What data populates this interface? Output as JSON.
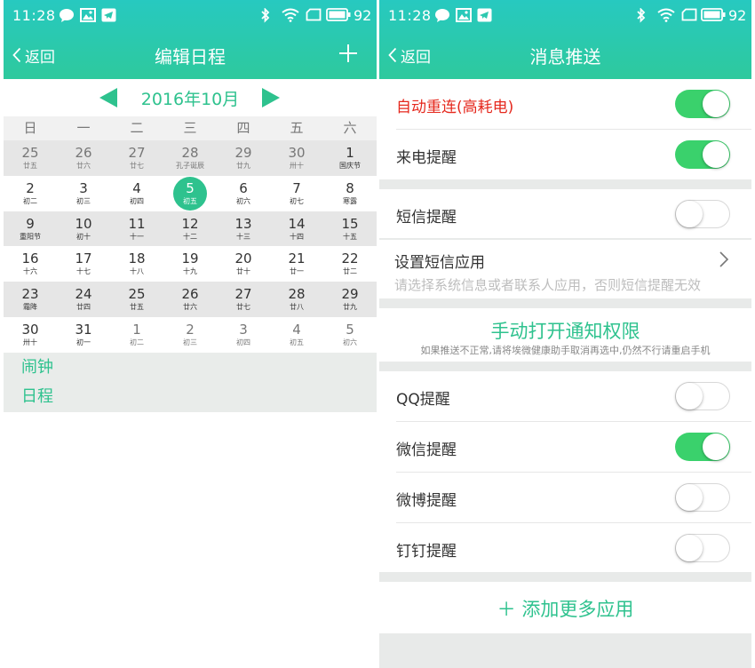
{
  "left": {
    "status": {
      "time": "11:28",
      "battery": "92"
    },
    "nav": {
      "back_label": "返回",
      "title": "编辑日程"
    },
    "calendar": {
      "month_label": "2016年10月",
      "weekdays": [
        "日",
        "一",
        "二",
        "三",
        "四",
        "五",
        "六"
      ],
      "weeks": [
        [
          [
            "25",
            "廿五"
          ],
          [
            "26",
            "廿六"
          ],
          [
            "27",
            "廿七"
          ],
          [
            "28",
            "孔子诞辰"
          ],
          [
            "29",
            "廿九"
          ],
          [
            "30",
            "卅十"
          ],
          [
            "1",
            "国庆节"
          ]
        ],
        [
          [
            "2",
            "初二"
          ],
          [
            "3",
            "初三"
          ],
          [
            "4",
            "初四"
          ],
          [
            "5",
            "初五"
          ],
          [
            "6",
            "初六"
          ],
          [
            "7",
            "初七"
          ],
          [
            "8",
            "寒露"
          ]
        ],
        [
          [
            "9",
            "重阳节"
          ],
          [
            "10",
            "初十"
          ],
          [
            "11",
            "十一"
          ],
          [
            "12",
            "十二"
          ],
          [
            "13",
            "十三"
          ],
          [
            "14",
            "十四"
          ],
          [
            "15",
            "十五"
          ]
        ],
        [
          [
            "16",
            "十六"
          ],
          [
            "17",
            "十七"
          ],
          [
            "18",
            "十八"
          ],
          [
            "19",
            "十九"
          ],
          [
            "20",
            "廿十"
          ],
          [
            "21",
            "廿一"
          ],
          [
            "22",
            "廿二"
          ]
        ],
        [
          [
            "23",
            "霜降"
          ],
          [
            "24",
            "廿四"
          ],
          [
            "25",
            "廿五"
          ],
          [
            "26",
            "廿六"
          ],
          [
            "27",
            "廿七"
          ],
          [
            "28",
            "廿八"
          ],
          [
            "29",
            "廿九"
          ]
        ],
        [
          [
            "30",
            "卅十"
          ],
          [
            "31",
            "初一"
          ],
          [
            "1",
            "初二"
          ],
          [
            "2",
            "初三"
          ],
          [
            "3",
            "初四"
          ],
          [
            "4",
            "初五"
          ],
          [
            "5",
            "初六"
          ]
        ]
      ],
      "selected_day": "5"
    },
    "extras": [
      "闹钟",
      "日程"
    ]
  },
  "right": {
    "status": {
      "time": "11:28",
      "battery": "92"
    },
    "nav": {
      "back_label": "返回",
      "title": "消息推送"
    },
    "auto_reconnect": {
      "label": "自动重连(高耗电)",
      "on": true
    },
    "call_reminder": {
      "label": "来电提醒",
      "on": true
    },
    "sms_reminder": {
      "label": "短信提醒",
      "on": false
    },
    "sms_app": {
      "title": "设置短信应用",
      "hint": "请选择系统信息或者联系人应用，否则短信提醒无效"
    },
    "notify": {
      "link": "手动打开通知权限",
      "hint": "如果推送不正常,请将埃微健康助手取消再选中,仍然不行请重启手机"
    },
    "apps": [
      {
        "label": "QQ提醒",
        "on": false
      },
      {
        "label": "微信提醒",
        "on": true
      },
      {
        "label": "微博提醒",
        "on": false
      },
      {
        "label": "钉钉提醒",
        "on": false
      }
    ],
    "add_more": "＋ 添加更多应用"
  },
  "colors": {
    "header": "#27c9c0",
    "accent": "#2ec28e",
    "toggle_on": "#3ad16c",
    "warning_text": "#e5281d"
  }
}
